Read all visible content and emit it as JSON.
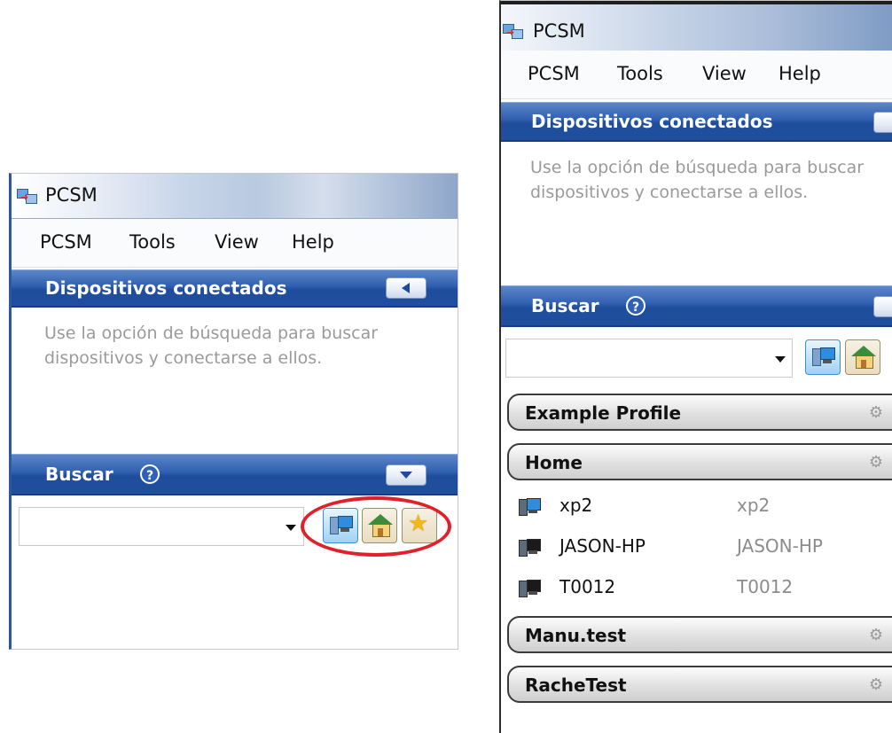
{
  "left_window": {
    "title": "PCSM",
    "menu": [
      "PCSM",
      "Tools",
      "View",
      "Help"
    ],
    "connected_section": {
      "title": "Dispositivos conectados",
      "hint_line1": "Use la opción de búsqueda para buscar",
      "hint_line2": "dispositivos y conectarse a ellos."
    },
    "search_section": {
      "title": "Buscar",
      "help_glyph": "?",
      "input_value": ""
    },
    "toolbar_icons": [
      "computer-icon",
      "home-icon",
      "star-icon"
    ],
    "highlight_color": "#e0202a"
  },
  "right_window": {
    "title": "PCSM",
    "menu": [
      "PCSM",
      "Tools",
      "View",
      "Help"
    ],
    "connected_section": {
      "title": "Dispositivos conectados",
      "hint_line1": "Use la opción de búsqueda para buscar",
      "hint_line2": "dispositivos y conectarse a ellos."
    },
    "search_section": {
      "title": "Buscar",
      "help_glyph": "?",
      "input_value": ""
    },
    "groups": [
      {
        "label": "Example Profile",
        "devices": []
      },
      {
        "label": "Home",
        "devices": [
          {
            "name": "xp2",
            "host": "xp2",
            "icon_color": "#2f8de0"
          },
          {
            "name": "JASON-HP",
            "host": "JASON-HP",
            "icon_color": "#1a1a1a"
          },
          {
            "name": "T0012",
            "host": "T0012",
            "icon_color": "#1a1a1a"
          }
        ]
      },
      {
        "label": "Manu.test",
        "devices": []
      },
      {
        "label": "RacheTest",
        "devices": []
      }
    ]
  },
  "colors": {
    "section_header": "#2f5fb0",
    "hint_text": "#9a9a9a"
  }
}
